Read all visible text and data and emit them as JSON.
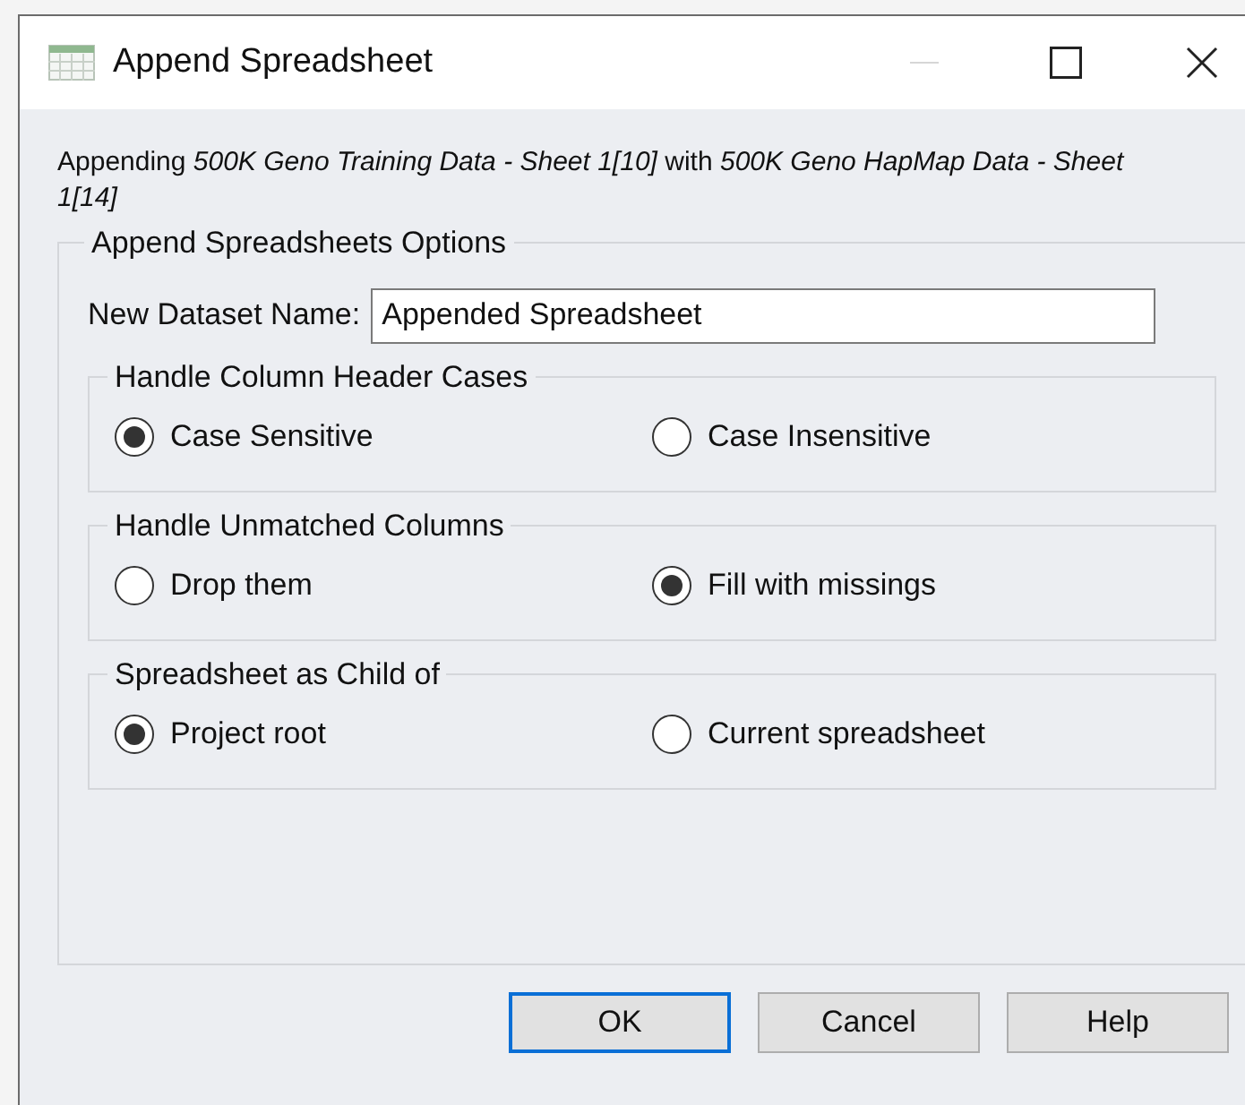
{
  "window": {
    "title": "Append Spreadsheet"
  },
  "description": "Appending *500K Geno Training Data - Sheet 1[10]* with *500K Geno HapMap Data - Sheet 1[14]*",
  "options_group": {
    "title": "Append Spreadsheets Options",
    "name_field": {
      "label": "New Dataset Name:",
      "value": "Appended Spreadsheet"
    },
    "groups": [
      {
        "title": "Handle Column Header Cases",
        "options": [
          {
            "label": "Case Sensitive",
            "selected": true
          },
          {
            "label": "Case Insensitive",
            "selected": false
          }
        ]
      },
      {
        "title": "Handle Unmatched Columns",
        "options": [
          {
            "label": "Drop them",
            "selected": false
          },
          {
            "label": "Fill with missings",
            "selected": true
          }
        ]
      },
      {
        "title": "Spreadsheet as Child of",
        "options": [
          {
            "label": "Project root",
            "selected": true
          },
          {
            "label": "Current spreadsheet",
            "selected": false
          }
        ]
      }
    ]
  },
  "buttons": [
    {
      "label": "OK",
      "default": true
    },
    {
      "label": "Cancel",
      "default": false
    },
    {
      "label": "Help",
      "default": false
    }
  ]
}
